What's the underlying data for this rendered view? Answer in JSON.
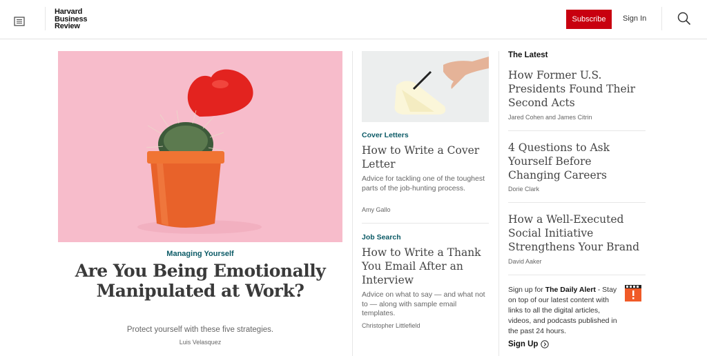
{
  "header": {
    "logo_lines": [
      "Harvard",
      "Business",
      "Review"
    ],
    "subscribe_label": "Subscribe",
    "signin_label": "Sign In",
    "accent_color": "#c8000f"
  },
  "hero": {
    "kicker": "Managing Yourself",
    "title": "Are You Being Emotionally Manipulated at Work?",
    "dek": "Protect yourself with these five strategies.",
    "author": "Luis Velasquez"
  },
  "middle": {
    "articles": [
      {
        "kicker": "Cover Letters",
        "title": "How to Write a Cover Letter",
        "dek": "Advice for tackling one of the toughest parts of the job-hunting process.",
        "author": "Amy Gallo"
      },
      {
        "kicker": "Job Search",
        "title": "How to Write a Thank You Email After an Interview",
        "dek": "Advice on what to say — and what not to — along with sample email templates.",
        "author": "Christopher Littlefield"
      }
    ]
  },
  "latest": {
    "heading": "The Latest",
    "items": [
      {
        "title": "How Former U.S. Presidents Found Their Second Acts",
        "author": "Jared Cohen and James Citrin"
      },
      {
        "title": "4 Questions to Ask Yourself Before Changing Careers",
        "author": "Dorie Clark"
      },
      {
        "title": "How a Well-Executed Social Initiative Strengthens Your Brand",
        "author": "David Aaker"
      }
    ],
    "alert": {
      "prefix": "Sign up for ",
      "name": "The Daily Alert",
      "suffix": " - Stay on top of our latest content with links to all the digital articles, videos, and podcasts published in the past 24 hours."
    },
    "signup_label": "Sign Up"
  },
  "icons": {
    "menu": "menu-icon",
    "search": "search-icon",
    "alert": "alert-icon",
    "signup_arrow": "arrow-circle-right-icon"
  }
}
